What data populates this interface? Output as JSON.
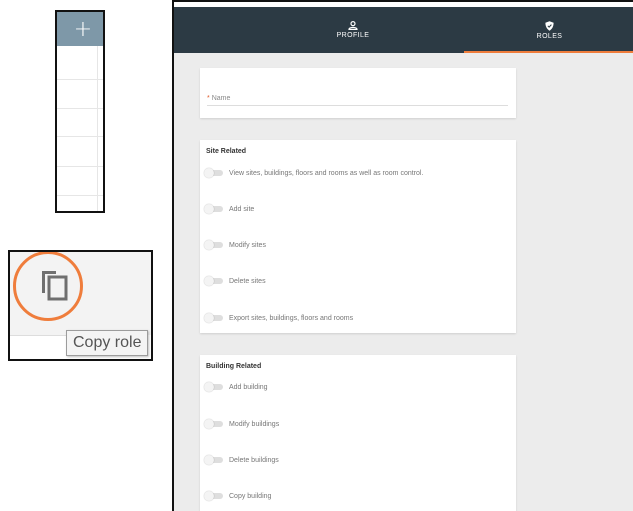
{
  "inset_table": {
    "add_button_label": "+"
  },
  "inset_copy": {
    "icon": "copy-icon",
    "tooltip": "Copy role"
  },
  "tabs": [
    {
      "label": "PROFILE",
      "icon": "user-icon"
    },
    {
      "label": "ROLES",
      "icon": "shield-icon"
    }
  ],
  "name_field": {
    "required_marker": "*",
    "placeholder": "Name"
  },
  "site_related": {
    "title": "Site Related",
    "permissions": [
      "View sites, buildings, floors and rooms as well as room control.",
      "Add site",
      "Modify sites",
      "Delete sites",
      "Export sites, buildings, floors and rooms"
    ]
  },
  "building_related": {
    "title": "Building Related",
    "permissions": [
      "Add building",
      "Modify buildings",
      "Delete buildings",
      "Copy building"
    ]
  },
  "colors": {
    "accent": "#ef7d3c",
    "topbar": "#2c3a44",
    "table_header": "#7e98a8"
  }
}
